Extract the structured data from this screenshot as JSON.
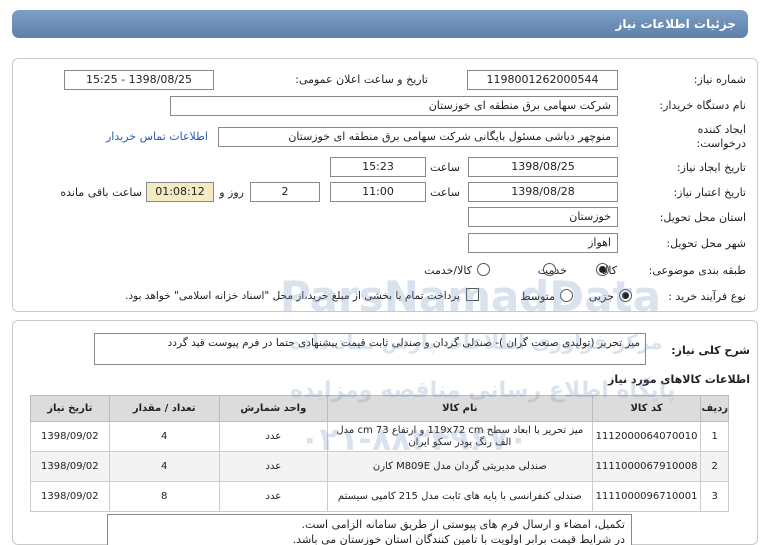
{
  "header": {
    "title": "جزئیات اطلاعات نیاز"
  },
  "form": {
    "need_number_label": "شماره نیاز:",
    "need_number": "1198001262000544",
    "announce_label": "تاریخ و ساعت اعلان عمومی:",
    "announce_value": "1398/08/25 - 15:25",
    "buyer_label": "نام دستگاه خریدار:",
    "buyer_value": "شرکت سهامی برق منطقه ای خوزستان",
    "creator_label_1": "ایجاد کننده",
    "creator_label_2": "درخواست:",
    "creator_value": "منوچهر دیاشی مسئول بایگانی شرکت سهامی برق منطقه ای خوزستان",
    "contact_link": "اطلاعات تماس خریدار",
    "need_date_label": "تاریخ ایجاد نیاز:",
    "need_date": "1398/08/25",
    "time_label": "ساعت",
    "need_time": "15:23",
    "validity_label": "تاریخ اعتبار نیاز:",
    "validity_date": "1398/08/28",
    "validity_time": "11:00",
    "days_value": "2",
    "days_label": "روز و",
    "remaining_time": "01:08:12",
    "remaining_label": "ساعت باقی مانده",
    "province_label": "استان محل تحویل:",
    "province_value": "خوزستان",
    "city_label": "شهر محل تحویل:",
    "city_value": "اهواز",
    "category_label": "طبقه بندی موضوعی:",
    "category_options": [
      "کالا",
      "خدمت",
      "کالا/خدمت"
    ],
    "category_selected": "کالا",
    "process_label": "نوع فرآیند خرید :",
    "process_options": [
      "جزیی",
      "متوسط"
    ],
    "process_selected": "جزیی",
    "payment_note": "پرداخت تمام یا بخشی از مبلغ خرید،از محل \"اسناد خزانه اسلامی\" خواهد بود."
  },
  "description": {
    "label": "شرح کلی نیاز:",
    "value": "میز تحریر (تولیدی صنعت گران )- صندلی گردان و صندلی ثابت قیمت پیشنهادی حتما در فرم پیوست قید گردد"
  },
  "items_section": {
    "title": "اطلاعات کالاهای مورد نیاز",
    "columns": [
      "ردیف",
      "کد کالا",
      "نام کالا",
      "واحد شمارش",
      "تعداد / مقدار",
      "تاریخ نیاز"
    ],
    "rows": [
      {
        "idx": "1",
        "code": "1112000064070010",
        "name": "میز تحریر با ابعاد سطح 119x72 cm و ارتفاع 73 cm مدل الف رنگ پودر سکو ایران",
        "unit": "عدد",
        "qty": "4",
        "date": "1398/09/02"
      },
      {
        "idx": "2",
        "code": "1111000067910008",
        "name": "صندلی مدیریتی گردان مدل M809E کارن",
        "unit": "عدد",
        "qty": "4",
        "date": "1398/09/02"
      },
      {
        "idx": "3",
        "code": "1111000096710001",
        "name": "صندلی کنفرانسی با پایه های ثابت مدل 215 کامپی سیستم",
        "unit": "عدد",
        "qty": "8",
        "date": "1398/09/02"
      }
    ]
  },
  "notes": {
    "line1": "تکمیل، امضاء و ارسال فرم های پیوستی از طریق سامانه الزامی است.",
    "line2": "در شرایط  قیمت برابر اولویت با تامین کنندگان استان خوزستان می باشد."
  },
  "watermark": {
    "brand": "ParsNamadData",
    "line1": "مرکز فراوری اطلاعات پارس نماد داده",
    "line2": "پایگاه اطلاع رسانی مناقصه ومزایده",
    "phone": "۰۲۱-۸۸۳۴۹۶۷۰"
  },
  "colors": {
    "title_bar": "#6b8db6",
    "link": "#2a5db0",
    "remaining_bg": "#f4eac4"
  }
}
